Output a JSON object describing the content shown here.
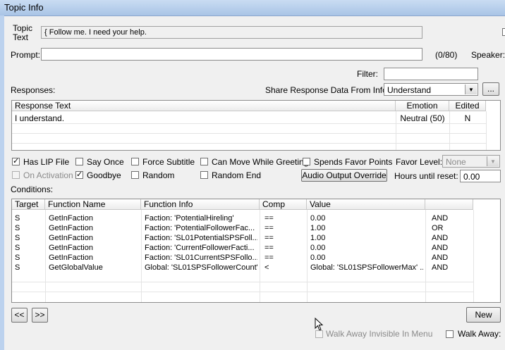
{
  "window": {
    "title": "Topic Info"
  },
  "topic_text": {
    "label_line1": "Topic",
    "label_line2": "Text",
    "value": "{ Follow me. I need your help."
  },
  "prompt": {
    "label": "Prompt:",
    "value": "",
    "counter": "(0/80)"
  },
  "speaker": {
    "label": "Speaker:"
  },
  "filter": {
    "label": "Filter:",
    "value": ""
  },
  "responses": {
    "label": "Responses:",
    "share_label": "Share Response Data From Info:",
    "share_value": "Understand",
    "ellipsis": "...",
    "columns": [
      "Response Text",
      "Emotion",
      "Edited"
    ],
    "rows": [
      {
        "text": "I understand.",
        "emotion": "Neutral (50)",
        "edited": "N"
      }
    ]
  },
  "options": {
    "has_lip": "Has LIP File",
    "say_once": "Say Once",
    "force_subtitle": "Force Subtitle",
    "can_move": "Can Move While Greeting",
    "spends_favor": "Spends Favor Points",
    "favor_level_label": "Favor Level:",
    "favor_level_value": "None",
    "on_activation": "On Activation",
    "goodbye": "Goodbye",
    "random": "Random",
    "random_end": "Random End",
    "audio_override": "Audio Output Override",
    "hours_label": "Hours until reset:",
    "hours_value": "0.00",
    "check_mark": "✓"
  },
  "conditions": {
    "label": "Conditions:",
    "columns": [
      "Target",
      "Function Name",
      "Function Info",
      "Comp",
      "Value",
      ""
    ],
    "rows": [
      {
        "target": "S",
        "fn": "GetInFaction",
        "info": "Faction: 'PotentialHireling'",
        "comp": "==",
        "value": "0.00",
        "op": "AND"
      },
      {
        "target": "S",
        "fn": "GetInFaction",
        "info": "Faction: 'PotentialFollowerFac...",
        "comp": "==",
        "value": "1.00",
        "op": "OR"
      },
      {
        "target": "S",
        "fn": "GetInFaction",
        "info": "Faction: 'SL01PotentialSPSFoll...",
        "comp": "==",
        "value": "1.00",
        "op": "AND"
      },
      {
        "target": "S",
        "fn": "GetInFaction",
        "info": "Faction: 'CurrentFollowerFacti...",
        "comp": "==",
        "value": "0.00",
        "op": "AND"
      },
      {
        "target": "S",
        "fn": "GetInFaction",
        "info": "Faction: 'SL01CurrentSPSFollo...",
        "comp": "==",
        "value": "0.00",
        "op": "AND"
      },
      {
        "target": "S",
        "fn": "GetGlobalValue",
        "info": "Global: 'SL01SPSFollowerCount'",
        "comp": "<",
        "value": "Global: 'SL01SPSFollowerMax' ...",
        "op": "AND"
      }
    ]
  },
  "nav": {
    "prev": "<<",
    "next": ">>",
    "new": "New"
  },
  "footer": {
    "walk_away_invisible": "Walk Away Invisible In Menu",
    "walk_away": "Walk Away:"
  }
}
